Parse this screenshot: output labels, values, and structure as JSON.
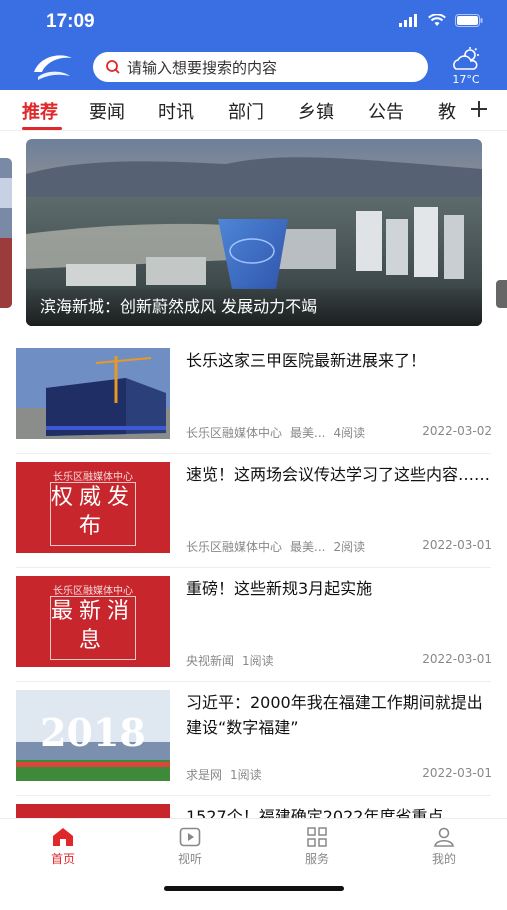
{
  "status": {
    "time": "17:09"
  },
  "header": {
    "search_placeholder": "请输入想要搜索的内容",
    "weather_temp": "17°C"
  },
  "tabs": [
    {
      "label": "推荐",
      "active": true
    },
    {
      "label": "要闻"
    },
    {
      "label": "时讯"
    },
    {
      "label": "部门"
    },
    {
      "label": "乡镇"
    },
    {
      "label": "公告"
    },
    {
      "label": "教"
    }
  ],
  "banner": {
    "caption": "滨海新城：创新蔚然成风 发展动力不竭"
  },
  "news": [
    {
      "title": "长乐这家三甲医院最新进展来了！",
      "source": "长乐区融媒体中心",
      "tag": "最美...",
      "reads": "4阅读",
      "date": "2022-03-02",
      "thumb": "photo-building"
    },
    {
      "title": "速览！这两场会议传达学习了这些内容……",
      "source": "长乐区融媒体中心",
      "tag": "最美...",
      "reads": "2阅读",
      "date": "2022-03-01",
      "thumb": "red",
      "thumb_top": "长乐区融媒体中心",
      "thumb_text": "权威发布"
    },
    {
      "title": "重磅！这些新规3月起实施",
      "source": "央视新闻",
      "tag": "",
      "reads": "1阅读",
      "date": "2022-03-01",
      "thumb": "red",
      "thumb_top": "长乐区融媒体中心",
      "thumb_text": "最新消息"
    },
    {
      "title": "习近平：2000年我在福建工作期间就提出建设“数字福建”",
      "source": "求是网",
      "tag": "",
      "reads": "1阅读",
      "date": "2022-03-01",
      "thumb": "photo-2018",
      "thumb_text": "2018"
    },
    {
      "title": "1527个！福建确定2022年度省重点",
      "source": "",
      "tag": "",
      "reads": "",
      "date": "",
      "thumb": "red"
    }
  ],
  "bottom_nav": [
    {
      "label": "首页",
      "icon": "home-icon",
      "active": true
    },
    {
      "label": "视听",
      "icon": "play-icon"
    },
    {
      "label": "服务",
      "icon": "grid-icon"
    },
    {
      "label": "我的",
      "icon": "user-icon"
    }
  ],
  "colors": {
    "brand_blue": "#3a6fe4",
    "accent_red": "#e0282a"
  }
}
